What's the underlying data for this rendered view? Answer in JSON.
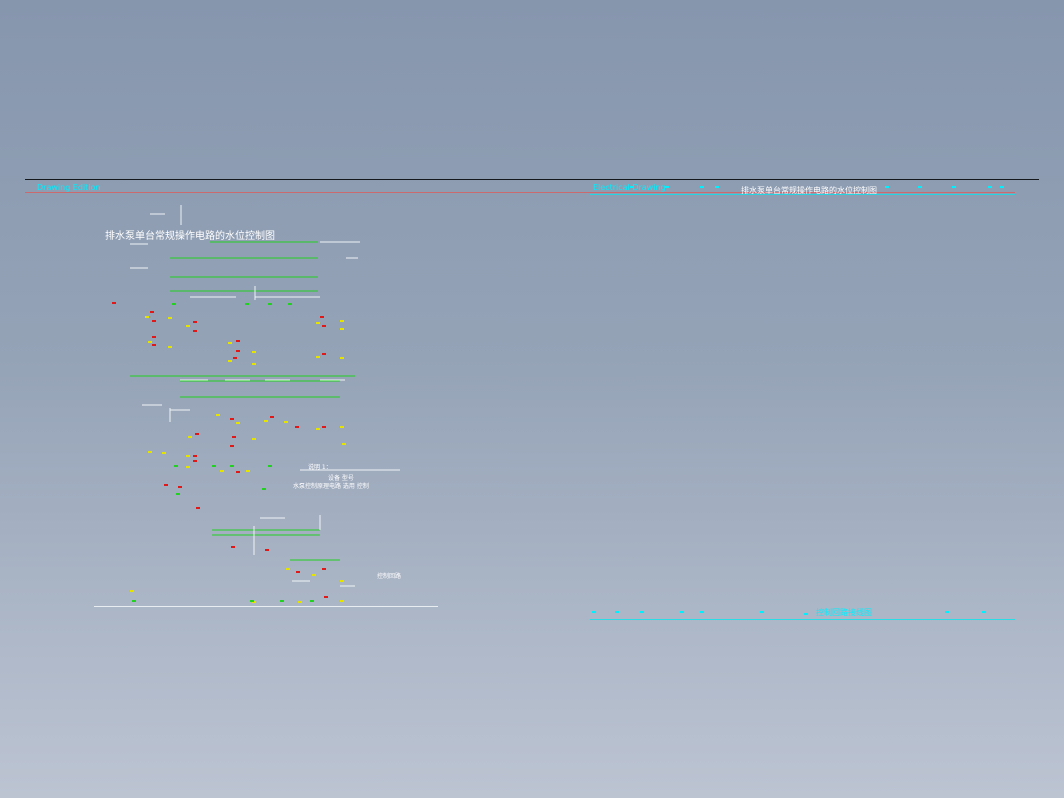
{
  "drawing": {
    "header_left": "Drawing Edition",
    "header_right_lead": "Electrical Drawing",
    "header_drawing_title": "排水泵单台常规操作电路的水位控制图",
    "footer_note": "控制回路接线图"
  },
  "main_drawing_title": "排水泵单台常规操作电路的水位控制图",
  "notes": {
    "note_1": "说明 1：",
    "note_2": "水泵控制原理电路 选用 控制",
    "note_3": "设备 型号",
    "note_4": "控制回路",
    "note_5": "控制回路接线图"
  },
  "colors": {
    "background_top": "#8696ad",
    "background_bottom": "#bcc4d2",
    "title_block_text": "#00f0ff",
    "drawing_lines": "#eef3f6",
    "green_lines": "#22d022",
    "red_labels": "#e01818",
    "yellow_labels": "#e4e400",
    "border_line": "#15181c",
    "border_accent": "#d95c5c"
  }
}
